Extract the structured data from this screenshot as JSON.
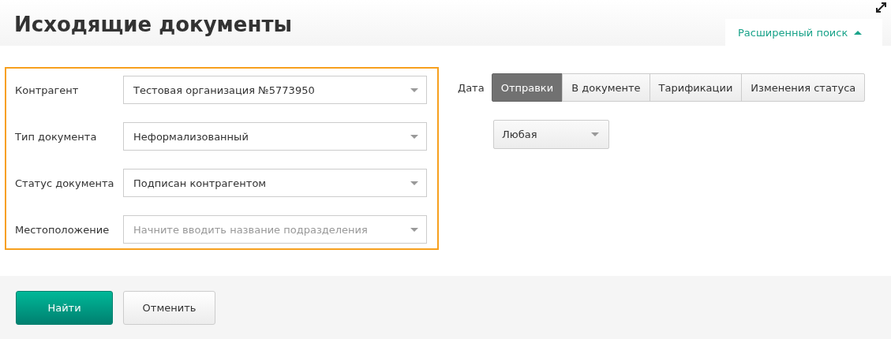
{
  "title": "Исходящие документы",
  "advanced_search": {
    "label": "Расширенный поиск",
    "expanded": true
  },
  "filters": [
    {
      "label": "Контрагент",
      "value": "Тестовая организация №5773950"
    },
    {
      "label": "Тип документа",
      "value": "Неформализованный"
    },
    {
      "label": "Статус документа",
      "value": "Подписан контрагентом"
    },
    {
      "label": "Местоположение",
      "placeholder": "Начните вводить название подразделения"
    }
  ],
  "date": {
    "label": "Дата",
    "tabs": [
      {
        "label": "Отправки",
        "selected": true
      },
      {
        "label": "В документе",
        "selected": false
      },
      {
        "label": "Тарификации",
        "selected": false
      },
      {
        "label": "Изменения статуса",
        "selected": false
      }
    ],
    "period": "Любая"
  },
  "buttons": [
    {
      "label": "Найти",
      "kind": "primary"
    },
    {
      "label": "Отменить",
      "kind": "secondary"
    }
  ]
}
